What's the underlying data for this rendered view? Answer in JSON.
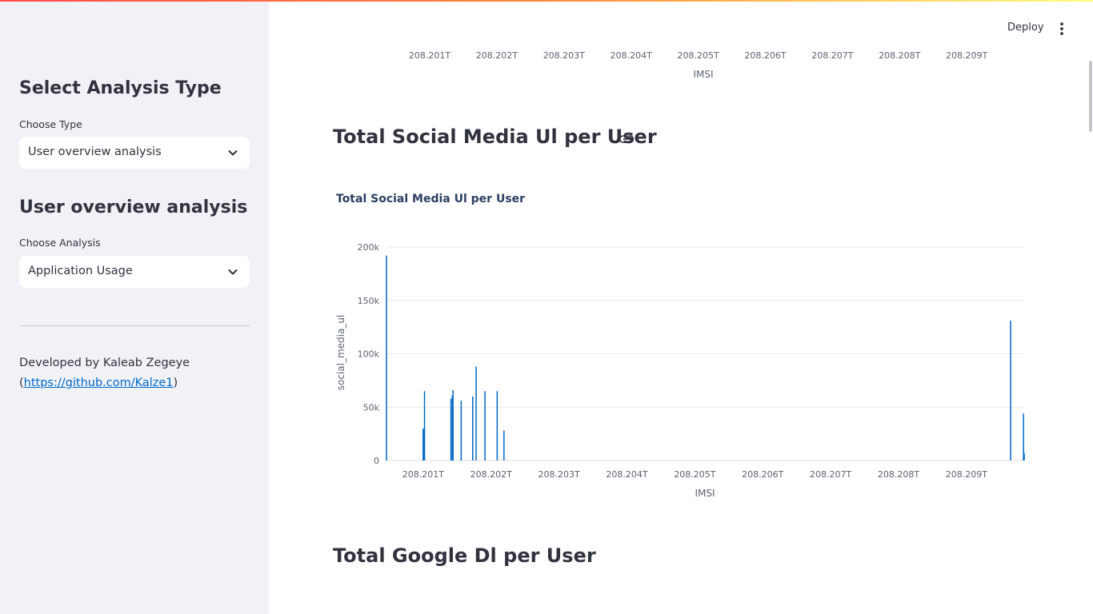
{
  "sidebar": {
    "analysis_type_heading": "Select Analysis Type",
    "type_label": "Choose Type",
    "type_selected": "User overview analysis",
    "section_heading": "User overview analysis",
    "analysis_label": "Choose Analysis",
    "analysis_selected": "Application Usage",
    "credit_text": "Developed by Kaleab Zegeye",
    "credit_open": "(",
    "credit_link": "https://github.com/Kalze1",
    "credit_close": ")"
  },
  "toolbar": {
    "deploy_label": "Deploy",
    "menu_icon": "kebab-menu-icon"
  },
  "main": {
    "section1_title": "Total Social Media Ul per User",
    "section2_title": "Total Google Dl per User",
    "anchor_icon": "link-icon"
  },
  "colors": {
    "accent": "#0068c9",
    "bar": "#0068c9",
    "sidebar_bg": "#f0f2f6"
  },
  "prev_chart": {
    "x_ticks": [
      "208.201T",
      "208.202T",
      "208.203T",
      "208.204T",
      "208.205T",
      "208.206T",
      "208.207T",
      "208.208T",
      "208.209T"
    ],
    "xlabel": "IMSI"
  },
  "chart_data": {
    "type": "bar",
    "title": "Total Social Media Ul per User",
    "xlabel": "IMSI",
    "ylabel": "social_media_ul",
    "x_ticks": [
      "208.201T",
      "208.202T",
      "208.203T",
      "208.204T",
      "208.205T",
      "208.206T",
      "208.207T",
      "208.208T",
      "208.209T"
    ],
    "x_tick_values": [
      208.201,
      208.202,
      208.203,
      208.204,
      208.205,
      208.206,
      208.207,
      208.208,
      208.209
    ],
    "xlim": [
      208.20046,
      208.20985
    ],
    "y_ticks": [
      "0",
      "50k",
      "100k",
      "150k",
      "200k"
    ],
    "y_tick_values": [
      0,
      50000,
      100000,
      150000,
      200000
    ],
    "ylim": [
      0,
      200000
    ],
    "grid": true,
    "series": [
      {
        "x": [
          208.20046,
          208.201,
          208.20101,
          208.20102,
          208.20141,
          208.20143,
          208.20144,
          208.20156,
          208.20173,
          208.20178,
          208.20191,
          208.20209,
          208.20219,
          208.20965,
          208.20984,
          208.20985
        ],
        "values": [
          192000,
          30000,
          28000,
          65000,
          58000,
          61000,
          66000,
          56000,
          60000,
          88000,
          65000,
          65000,
          28000,
          131000,
          44000,
          7000
        ]
      }
    ]
  }
}
